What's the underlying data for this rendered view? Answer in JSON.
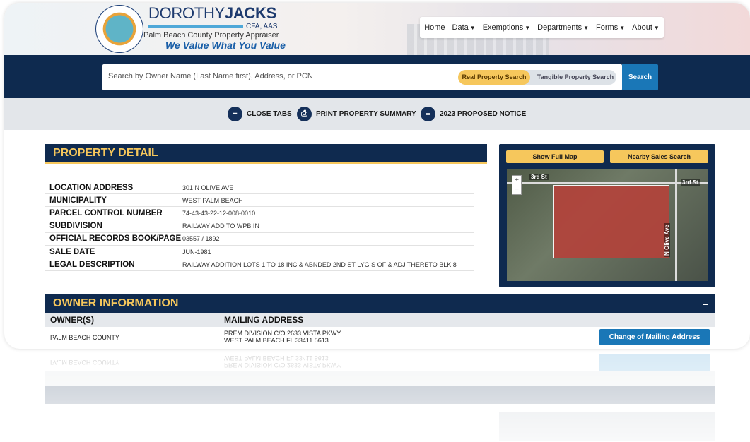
{
  "header": {
    "logo_name_first": "DOROTHY",
    "logo_name_last": "JACKS",
    "logo_credentials": "CFA, AAS",
    "logo_subtitle": "Palm Beach County Property Appraiser",
    "logo_tagline": "We Value What You Value",
    "nav": [
      {
        "label": "Home",
        "has_dropdown": false
      },
      {
        "label": "Data",
        "has_dropdown": true
      },
      {
        "label": "Exemptions",
        "has_dropdown": true
      },
      {
        "label": "Departments",
        "has_dropdown": true
      },
      {
        "label": "Forms",
        "has_dropdown": true
      },
      {
        "label": "About",
        "has_dropdown": true
      }
    ]
  },
  "search": {
    "placeholder": "Search by Owner Name (Last Name first), Address, or PCN",
    "toggle_real": "Real Property Search",
    "toggle_tangible": "Tangible Property Search",
    "selected": "Real Property Search",
    "button_label": "Search"
  },
  "tools": {
    "close_tabs": "CLOSE TABS",
    "print_summary": "PRINT PROPERTY SUMMARY",
    "proposed_notice": "2023 PROPOSED NOTICE"
  },
  "property_detail": {
    "title": "PROPERTY DETAIL",
    "rows": [
      {
        "label": "LOCATION ADDRESS",
        "value": "301 N OLIVE AVE"
      },
      {
        "label": "MUNICIPALITY",
        "value": "WEST PALM BEACH"
      },
      {
        "label": "PARCEL CONTROL NUMBER",
        "value": "74-43-43-22-12-008-0010"
      },
      {
        "label": "SUBDIVISION",
        "value": "RAILWAY ADD TO WPB IN"
      },
      {
        "label": "OFFICIAL RECORDS BOOK/PAGE",
        "value": "03557 / 1892"
      },
      {
        "label": "SALE DATE",
        "value": "JUN-1981"
      },
      {
        "label": "LEGAL DESCRIPTION",
        "value": "RAILWAY ADDITION LOTS 1 TO 18 INC & ABNDED 2ND ST LYG S OF & ADJ THERETO BLK 8"
      }
    ]
  },
  "map": {
    "show_full_map": "Show Full Map",
    "nearby_sales": "Nearby Sales Search",
    "label_3rd_left": "3rd St",
    "label_3rd_right": "3rd St",
    "label_olive": "N Olive Ave",
    "zoom_in": "+",
    "zoom_out": "−"
  },
  "owner": {
    "title": "OWNER INFORMATION",
    "collapse": "–",
    "col_owners": "OWNER(S)",
    "col_mailing": "MAILING ADDRESS",
    "owner_name": "PALM BEACH COUNTY",
    "mailing_line1": "PREM DIVISION C/O 2633 VISTA PKWY",
    "mailing_line2": "WEST PALM BEACH FL 33411 5613",
    "change_button": "Change of Mailing Address"
  },
  "colors": {
    "navy": "#0f2a4f",
    "gold": "#f6c75c",
    "blue_button": "#1a77b7"
  }
}
